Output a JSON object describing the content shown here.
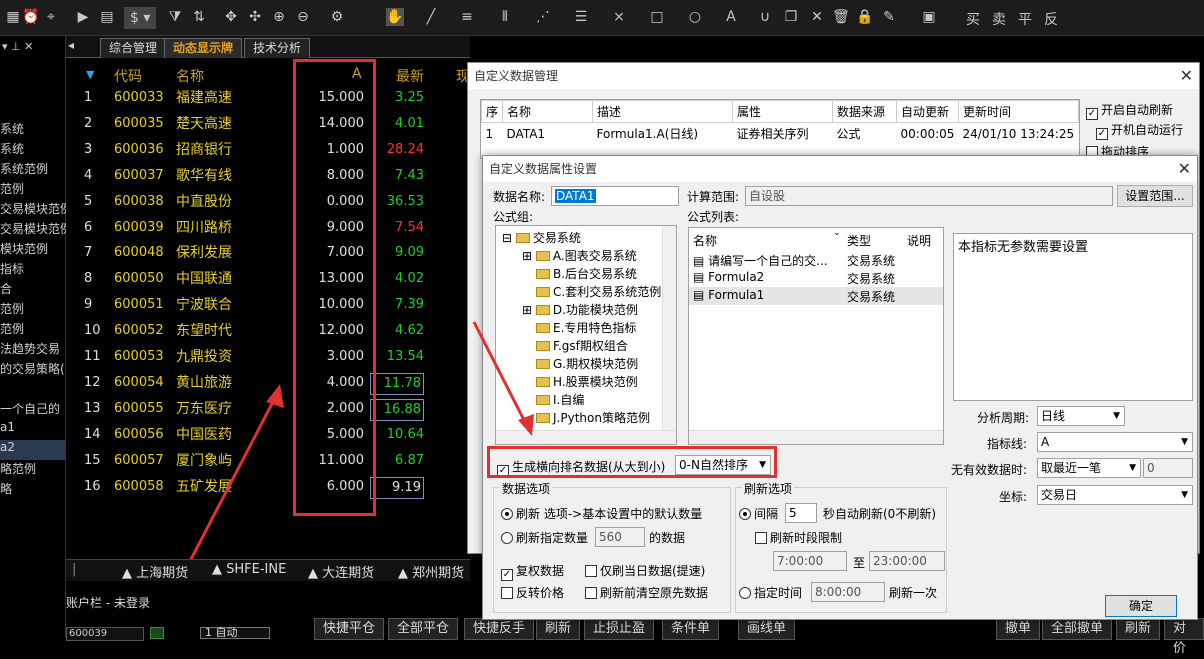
{
  "toolbar": {
    "dollar": "$",
    "actions": [
      "买",
      "卖",
      "平",
      "反"
    ]
  },
  "left_panel": {
    "items": [
      "系统",
      "系统",
      "系统范例",
      "范例",
      "交易模块范例",
      "交易模块范例",
      "模块范例",
      "指标",
      "合",
      "范例",
      "范例",
      "法趋势交易",
      "的交易策略(",
      "一个自己的",
      "a1",
      "a2",
      "略范例",
      "略"
    ]
  },
  "tabs": [
    {
      "label": "综合管理"
    },
    {
      "label": "动态显示牌"
    },
    {
      "label": "技术分析"
    }
  ],
  "grid": {
    "headers": {
      "code": "代码",
      "name": "名称",
      "a": "A",
      "new": "最新",
      "extra": "现"
    },
    "rows": [
      {
        "idx": "1",
        "code": "600033",
        "name": "福建高速",
        "a": "15.000",
        "new": "3.25",
        "new_color": "green"
      },
      {
        "idx": "2",
        "code": "600035",
        "name": "楚天高速",
        "a": "14.000",
        "new": "4.01",
        "new_color": "green"
      },
      {
        "idx": "3",
        "code": "600036",
        "name": "招商银行",
        "a": "1.000",
        "new": "28.24",
        "new_color": "red"
      },
      {
        "idx": "4",
        "code": "600037",
        "name": "歌华有线",
        "a": "8.000",
        "new": "7.43",
        "new_color": "green"
      },
      {
        "idx": "5",
        "code": "600038",
        "name": "中直股份",
        "a": "0.000",
        "new": "36.53",
        "new_color": "green"
      },
      {
        "idx": "6",
        "code": "600039",
        "name": "四川路桥",
        "a": "9.000",
        "new": "7.54",
        "new_color": "red"
      },
      {
        "idx": "7",
        "code": "600048",
        "name": "保利发展",
        "a": "7.000",
        "new": "9.09",
        "new_color": "green"
      },
      {
        "idx": "8",
        "code": "600050",
        "name": "中国联通",
        "a": "13.000",
        "new": "4.02",
        "new_color": "green"
      },
      {
        "idx": "9",
        "code": "600051",
        "name": "宁波联合",
        "a": "10.000",
        "new": "7.39",
        "new_color": "green"
      },
      {
        "idx": "10",
        "code": "600052",
        "name": "东望时代",
        "a": "12.000",
        "new": "4.62",
        "new_color": "green"
      },
      {
        "idx": "11",
        "code": "600053",
        "name": "九鼎投资",
        "a": "3.000",
        "new": "13.54",
        "new_color": "green"
      },
      {
        "idx": "12",
        "code": "600054",
        "name": "黄山旅游",
        "a": "4.000",
        "new": "11.78",
        "new_color": "green"
      },
      {
        "idx": "13",
        "code": "600055",
        "name": "万东医疗",
        "a": "2.000",
        "new": "16.88",
        "new_color": "green"
      },
      {
        "idx": "14",
        "code": "600056",
        "name": "中国医药",
        "a": "5.000",
        "new": "10.64",
        "new_color": "green"
      },
      {
        "idx": "15",
        "code": "600057",
        "name": "厦门象屿",
        "a": "11.000",
        "new": "6.87",
        "new_color": "green"
      },
      {
        "idx": "16",
        "code": "600058",
        "name": "五矿发展",
        "a": "6.000",
        "new": "9.19",
        "new_color": "white"
      }
    ]
  },
  "market_tabs": [
    "上海期货",
    "SHFE-INE",
    "大连期货",
    "郑州期货"
  ],
  "account": {
    "title": "账户栏 - 未登录",
    "code_value": "600039",
    "auto_label": "1 自动",
    "buttons": [
      "快捷平仓",
      "全部平仓",
      "快捷反手",
      "刷新",
      "止损止盈",
      "条件单",
      "画线单"
    ],
    "right_buttons": [
      "撤单",
      "全部撤单",
      "刷新",
      "对价"
    ]
  },
  "data_manager": {
    "title": "自定义数据管理",
    "columns": [
      "序",
      "名称",
      "描述",
      "属性",
      "数据来源",
      "自动更新",
      "更新时间"
    ],
    "row": {
      "seq": "1",
      "name": "DATA1",
      "desc": "Formula1.A(日线)",
      "attr": "证券相关序列",
      "source": "公式",
      "auto": "00:00:05",
      "time": "24/01/10 13:24:25"
    },
    "options": {
      "auto_refresh": "开启自动刷新",
      "startup_run": "开机自动运行",
      "drag_sort": "拖动排序"
    }
  },
  "prop_dialog": {
    "title": "自定义数据属性设置",
    "name_label": "数据名称:",
    "name_value": "DATA1",
    "range_label": "计算范围:",
    "range_value": "自设股",
    "range_button": "设置范围...",
    "formula_group_label": "公式组:",
    "tree_root": "交易系统",
    "tree_items": [
      "A.图表交易系统",
      "B.后台交易系统",
      "C.套利交易系统范例",
      "D.功能模块范例",
      "E.专用特色指标",
      "F.gsf期权组合",
      "G.期权模块范例",
      "H.股票模块范例",
      "I.自编",
      "J.Python策略范例"
    ],
    "formula_list_label": "公式列表:",
    "formula_columns": [
      "名称",
      "类型",
      "说明"
    ],
    "formulas": [
      {
        "name": "请编写一个自己的交...",
        "type": "交易系统"
      },
      {
        "name": "Formula2",
        "type": "交易系统"
      },
      {
        "name": "Formula1",
        "type": "交易系统"
      }
    ],
    "param_text": "本指标无参数需要设置",
    "period_label": "分析周期:",
    "period_value": "日线",
    "line_label": "指标线:",
    "line_value": "A",
    "invalid_label": "无有效数据时:",
    "invalid_value": "取最近一笔",
    "invalid_num": "0",
    "coord_label": "坐标:",
    "coord_value": "交易日",
    "rank_label": "生成横向排名数据(从大到小)",
    "rank_value": "0-N自然排序",
    "data_opts_title": "数据选项",
    "data_opt1": "刷新  选项->基本设置中的默认数量",
    "data_opt2": "刷新指定数量",
    "data_opt2_num": "560",
    "data_opt2_suffix": "的数据",
    "chk_fuquan": "复权数据",
    "chk_today": "仅刷当日数据(提速)",
    "chk_reverse": "反转价格",
    "chk_clear": "刷新前清空原先数据",
    "refresh_title": "刷新选项",
    "interval_label": "间隔",
    "interval_value": "5",
    "interval_suffix": "秒自动刷新(0不刷新)",
    "period_limit": "刷新时段限制",
    "time_from": "7:00:00",
    "time_to_label": "至",
    "time_to": "23:00:00",
    "fixed_time_label": "指定时间",
    "fixed_time": "8:00:00",
    "fixed_suffix": "刷新一次",
    "ok": "确定"
  }
}
